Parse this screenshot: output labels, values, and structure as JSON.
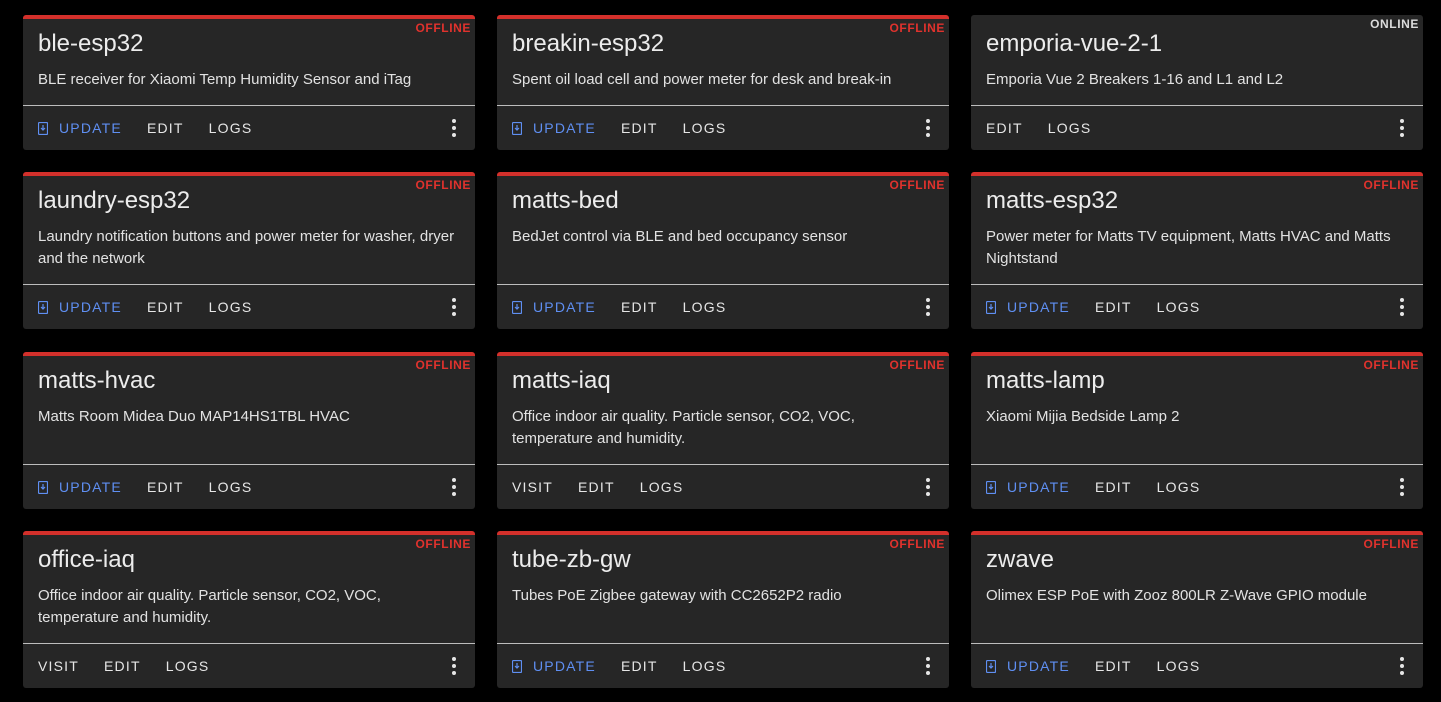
{
  "colors": {
    "background": "#000000",
    "card": "#262626",
    "offline": "#e0322d",
    "online": "#dcdcdc",
    "update_accent": "#5f8ff2"
  },
  "icons": {
    "update": "update-device-icon",
    "menu": "more-vertical-icon"
  },
  "devices": [
    {
      "name": "ble-esp32",
      "status": "OFFLINE",
      "description": "BLE receiver for Xiaomi Temp Humidity Sensor and iTag",
      "actions": [
        "UPDATE",
        "EDIT",
        "LOGS"
      ]
    },
    {
      "name": "breakin-esp32",
      "status": "OFFLINE",
      "description": "Spent oil load cell and power meter for desk and break-in",
      "actions": [
        "UPDATE",
        "EDIT",
        "LOGS"
      ]
    },
    {
      "name": "emporia-vue-2-1",
      "status": "ONLINE",
      "description": "Emporia Vue 2 Breakers 1-16 and L1 and L2",
      "actions": [
        "EDIT",
        "LOGS"
      ]
    },
    {
      "name": "laundry-esp32",
      "status": "OFFLINE",
      "description": "Laundry notification buttons and power meter for washer, dryer and the network",
      "actions": [
        "UPDATE",
        "EDIT",
        "LOGS"
      ]
    },
    {
      "name": "matts-bed",
      "status": "OFFLINE",
      "description": "BedJet control via BLE and bed occupancy sensor",
      "actions": [
        "UPDATE",
        "EDIT",
        "LOGS"
      ]
    },
    {
      "name": "matts-esp32",
      "status": "OFFLINE",
      "description": "Power meter for Matts TV equipment, Matts HVAC and Matts Nightstand",
      "actions": [
        "UPDATE",
        "EDIT",
        "LOGS"
      ]
    },
    {
      "name": "matts-hvac",
      "status": "OFFLINE",
      "description": "Matts Room Midea Duo MAP14HS1TBL HVAC",
      "actions": [
        "UPDATE",
        "EDIT",
        "LOGS"
      ]
    },
    {
      "name": "matts-iaq",
      "status": "OFFLINE",
      "description": "Office indoor air quality. Particle sensor, CO2, VOC, temperature and humidity.",
      "actions": [
        "VISIT",
        "EDIT",
        "LOGS"
      ]
    },
    {
      "name": "matts-lamp",
      "status": "OFFLINE",
      "description": "Xiaomi Mijia Bedside Lamp 2",
      "actions": [
        "UPDATE",
        "EDIT",
        "LOGS"
      ]
    },
    {
      "name": "office-iaq",
      "status": "OFFLINE",
      "description": "Office indoor air quality. Particle sensor, CO2, VOC, temperature and humidity.",
      "actions": [
        "VISIT",
        "EDIT",
        "LOGS"
      ]
    },
    {
      "name": "tube-zb-gw",
      "status": "OFFLINE",
      "description": "Tubes PoE Zigbee gateway with CC2652P2 radio",
      "actions": [
        "UPDATE",
        "EDIT",
        "LOGS"
      ]
    },
    {
      "name": "zwave",
      "status": "OFFLINE",
      "description": "Olimex ESP PoE with Zooz 800LR Z-Wave GPIO module",
      "actions": [
        "UPDATE",
        "EDIT",
        "LOGS"
      ]
    }
  ]
}
